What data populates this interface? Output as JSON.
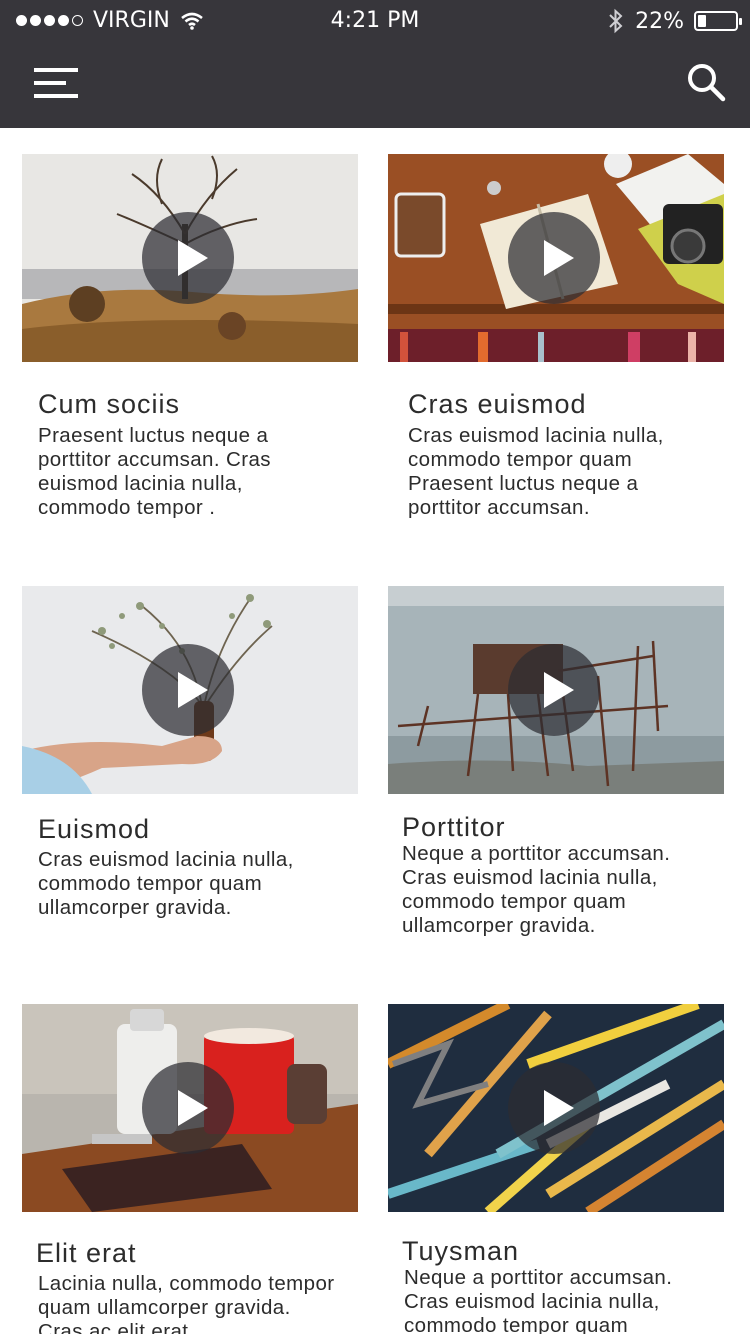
{
  "status_bar": {
    "carrier": "VIRGIN",
    "time": "4:21 PM",
    "battery_text": "22%",
    "battery_level": 0.22,
    "signal_bars": 4,
    "signal_total": 5
  },
  "nav": {
    "menu_icon": "hamburger-menu-icon",
    "search_icon": "search-icon",
    "background_color": "#37363b"
  },
  "cards": [
    {
      "title": "Cum sociis",
      "description": "Praesent luctus neque a porttitor accumsan. Cras euismod lacinia nulla, commodo tempor .",
      "image": "lone-tree-landscape"
    },
    {
      "title": "Cras euismod",
      "description": "Cras euismod lacinia nulla, commodo tempor quam Praesent luctus neque a porttitor accumsan.",
      "image": "desk-book-camera"
    },
    {
      "title": "Euismod",
      "description": "Cras euismod lacinia nulla, commodo tempor quam ullamcorper gravida.",
      "image": "hand-holding-vase"
    },
    {
      "title": "Porttitor",
      "description": "Neque a porttitor accumsan. Cras euismod lacinia nulla, commodo tempor quam ullamcorper gravida.",
      "image": "stilt-hut-sea"
    },
    {
      "title": "Elit erat",
      "description": "Lacinia nulla, commodo tempor quam ullamcorper gravida. Cras ac elit erat.",
      "image": "red-mug-table"
    },
    {
      "title": "Tuysman",
      "description": "Neque a porttitor accumsan. Cras euismod lacinia nulla, commodo tempor quam",
      "image": "folding-rulers"
    }
  ]
}
